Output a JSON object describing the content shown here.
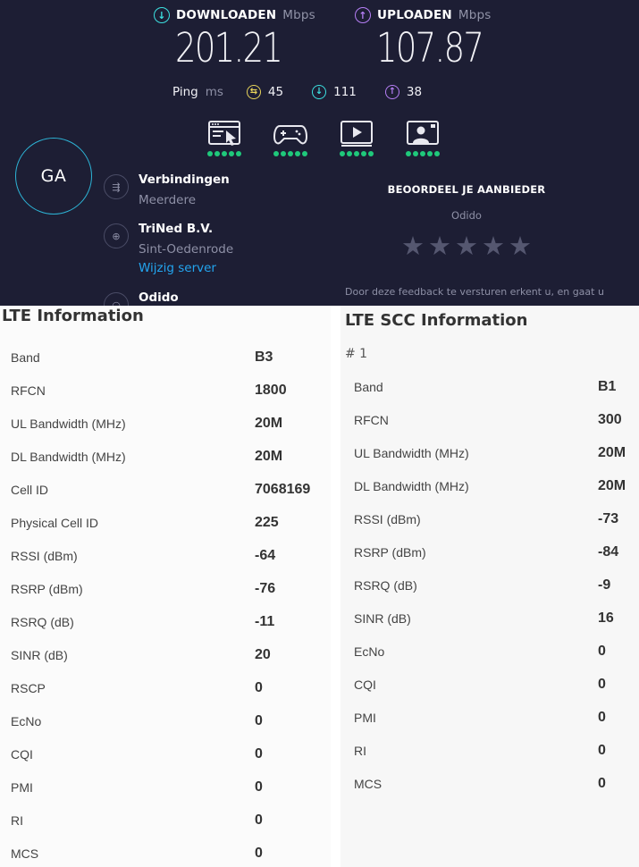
{
  "speedtest": {
    "download": {
      "label": "DOWNLOADEN",
      "unit": "Mbps",
      "value": "201.21"
    },
    "upload": {
      "label": "UPLOADEN",
      "unit": "Mbps",
      "value": "107.87"
    },
    "ping": {
      "label": "Ping",
      "unit": "ms",
      "idle": "45",
      "download": "111",
      "upload": "38"
    },
    "apps": [
      {
        "icon": "web-browsing-icon",
        "rating": 5
      },
      {
        "icon": "gaming-icon",
        "rating": 5
      },
      {
        "icon": "video-streaming-icon",
        "rating": 5
      },
      {
        "icon": "video-call-icon",
        "rating": 5
      }
    ],
    "user_initials": "GA",
    "connections": {
      "title": "Verbindingen",
      "value": "Meerdere"
    },
    "server": {
      "title": "TriNed B.V.",
      "location": "Sint-Oedenrode",
      "change_link": "Wijzig server"
    },
    "provider": {
      "name": "Odido"
    },
    "rating": {
      "title": "BEOORDEEL JE AANBIEDER",
      "provider": "Odido",
      "stars": 5,
      "feedback_text": "Door deze feedback te versturen erkent u, en gaat u"
    },
    "colors": {
      "background": "#1d1e34",
      "download": "#3ce0e0",
      "upload": "#b57ef5",
      "ping": "#e7d35a",
      "rating_dots": "#1fc97b",
      "link": "#23a5ef"
    }
  },
  "lte_info": {
    "title": "LTE Information",
    "rows": [
      {
        "label": "Band",
        "value": "B3"
      },
      {
        "label": "RFCN",
        "value": "1800"
      },
      {
        "label": "UL Bandwidth (MHz)",
        "value": "20M"
      },
      {
        "label": "DL Bandwidth (MHz)",
        "value": "20M"
      },
      {
        "label": "Cell ID",
        "value": "7068169"
      },
      {
        "label": "Physical Cell ID",
        "value": "225"
      },
      {
        "label": "RSSI (dBm)",
        "value": "-64"
      },
      {
        "label": "RSRP (dBm)",
        "value": "-76"
      },
      {
        "label": "RSRQ (dB)",
        "value": "-11"
      },
      {
        "label": "SINR (dB)",
        "value": "20"
      },
      {
        "label": "RSCP",
        "value": "0"
      },
      {
        "label": "EcNo",
        "value": "0"
      },
      {
        "label": "CQI",
        "value": "0"
      },
      {
        "label": "PMI",
        "value": "0"
      },
      {
        "label": "RI",
        "value": "0"
      },
      {
        "label": "MCS",
        "value": "0"
      }
    ]
  },
  "lte_scc_info": {
    "title": "LTE SCC Information",
    "index": "# 1",
    "rows": [
      {
        "label": "Band",
        "value": "B1"
      },
      {
        "label": "RFCN",
        "value": "300"
      },
      {
        "label": "UL Bandwidth (MHz)",
        "value": "20M"
      },
      {
        "label": "DL Bandwidth (MHz)",
        "value": "20M"
      },
      {
        "label": "RSSI (dBm)",
        "value": "-73"
      },
      {
        "label": "RSRP (dBm)",
        "value": "-84"
      },
      {
        "label": "RSRQ (dB)",
        "value": "-9"
      },
      {
        "label": "SINR (dB)",
        "value": "16"
      },
      {
        "label": "EcNo",
        "value": "0"
      },
      {
        "label": "CQI",
        "value": "0"
      },
      {
        "label": "PMI",
        "value": "0"
      },
      {
        "label": "RI",
        "value": "0"
      },
      {
        "label": "MCS",
        "value": "0"
      }
    ]
  }
}
